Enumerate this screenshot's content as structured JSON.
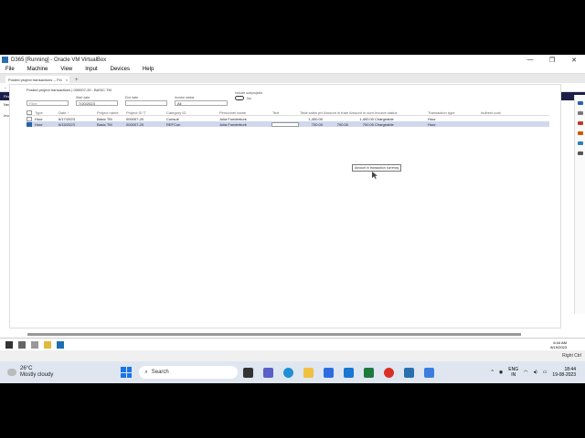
{
  "vbox": {
    "title": "D365 [Running] - Oracle VM VirtualBox",
    "menu": [
      "File",
      "Machine",
      "View",
      "Input",
      "Devices",
      "Help"
    ],
    "window_controls": [
      "—",
      "❐",
      "✕"
    ],
    "status_text": "Right Ctrl"
  },
  "browser": {
    "tab_title": "Posted project transactions -- Fin",
    "tab_close": "×",
    "tab_new": "+",
    "url_prefix": "Not secure",
    "url": "https://usnconeboxax1aos.cloud.onebox.dynamics.com/?cmp=usmf&mi=ProjPostedProjectTransactions",
    "toolbar_icons": "☆ ↻ ⋯"
  },
  "fo": {
    "app_title": "Finance and Operations",
    "search_placeholder": "Search for a page",
    "company": "USMF",
    "actions": [
      "New",
      "Process",
      "View",
      "Bill",
      "Options"
    ],
    "ribbon_view": "View",
    "ribbon_invoice": "Invoice proposal",
    "breadcrumb": "Posted project transactions | 000007-20 : BASIC TM",
    "filters": [
      {
        "label": "",
        "value": "Filter"
      },
      {
        "label": "Start date",
        "value": "7/20/2023"
      },
      {
        "label": "End date",
        "value": ""
      },
      {
        "label": "Invoice status",
        "value": "All"
      }
    ],
    "toggle_label": "Include subprojects",
    "toggle_value": "No",
    "columns": [
      "Type",
      "Date ↑",
      "Project name",
      "Project ID ▽",
      "Category ID",
      "Personnel name",
      "Text",
      "Total sales price",
      "Amount in transaction currency",
      "Amount in currency",
      "Invoice status",
      "Transaction type",
      "Indirect cost"
    ],
    "rows": [
      {
        "type": "Hour",
        "date": "6/17/2023",
        "name": "Basic TM",
        "pid": "000007-20",
        "cat": "Consult",
        "person": "Julia Funderburk",
        "text": "",
        "sales": "1,400.00",
        "amt": "",
        "amtc": "1,400.00",
        "status": "Chargeable",
        "ttype": "Hour",
        "indirect": ""
      },
      {
        "type": "Hour",
        "date": "6/15/2023",
        "name": "Basic TM",
        "pid": "000007-20",
        "cat": "REFCon",
        "person": "Julia Funderburk",
        "text": "",
        "sales": "700.00",
        "amt": "700.00",
        "amtc": "700.00",
        "status": "Chargeable",
        "ttype": "Hour",
        "indirect": ""
      }
    ],
    "tooltip": "Amount in transaction currency"
  },
  "vm_taskbar": {
    "time": "6:44 AM",
    "date": "8/19/2023"
  },
  "host": {
    "weather_temp": "26°C",
    "weather_desc": "Mostly cloudy",
    "search_label": "Search",
    "lang_top": "ENG",
    "lang_bottom": "IN",
    "time": "18:44",
    "date": "19-08-2023",
    "tray_arrow": "^"
  },
  "colors": {
    "fo_header": "#1e1e4a",
    "selection": "#cfd8ee",
    "accent": "#2a5fb0"
  }
}
